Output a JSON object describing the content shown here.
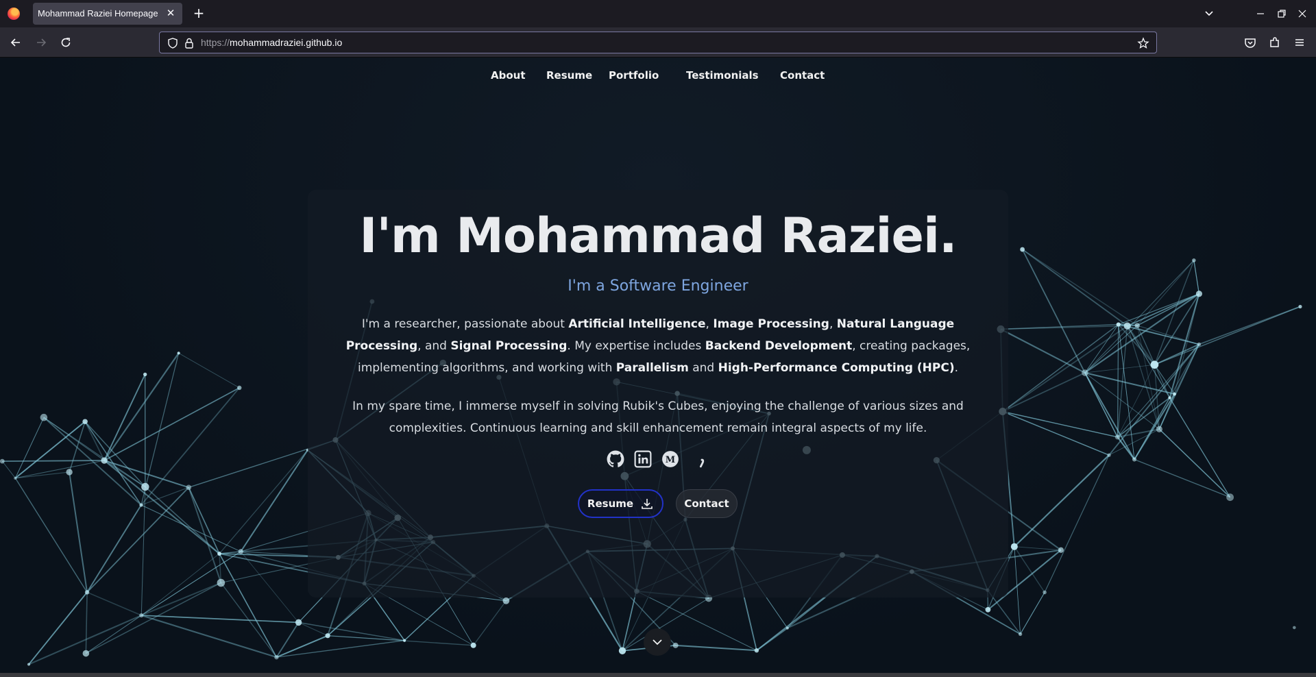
{
  "browser": {
    "tab_title": "Mohammad Raziei Homepage",
    "url_scheme": "https://",
    "url_host": "mohammadraziei.github.io"
  },
  "nav": {
    "items": [
      "About",
      "Resume",
      "Portfolio",
      "Testimonials",
      "Contact"
    ]
  },
  "hero": {
    "title": "I'm Mohammad Raziei.",
    "subtitle": "I'm a Software Engineer",
    "para1": [
      {
        "t": "I'm a researcher, passionate about ",
        "b": false
      },
      {
        "t": "Artificial Intelligence",
        "b": true
      },
      {
        "t": ", ",
        "b": false
      },
      {
        "t": "Image Processing",
        "b": true
      },
      {
        "t": ", ",
        "b": false
      },
      {
        "t": "Natural Language Processing",
        "b": true
      },
      {
        "t": ", and ",
        "b": false
      },
      {
        "t": "Signal Processing",
        "b": true
      },
      {
        "t": ". My expertise includes ",
        "b": false
      },
      {
        "t": "Backend Development",
        "b": true
      },
      {
        "t": ", creating packages, implementing algorithms, and working with ",
        "b": false
      },
      {
        "t": "Parallelism",
        "b": true
      },
      {
        "t": " and ",
        "b": false
      },
      {
        "t": "High-Performance Computing (HPC)",
        "b": true
      },
      {
        "t": ".",
        "b": false
      }
    ],
    "para2": "In my spare time, I immerse myself in solving Rubik's Cubes, enjoying the challenge of various sizes and complexities. Continuous learning and skill enhancement remain integral aspects of my life.",
    "socials": [
      "github-icon",
      "linkedin-icon",
      "medium-icon",
      "comma-icon"
    ],
    "resume_label": "Resume",
    "contact_label": "Contact"
  },
  "colors": {
    "accent": "#7ea6e0",
    "resume_border": "#2232c8",
    "network": "#7fc4d6"
  }
}
